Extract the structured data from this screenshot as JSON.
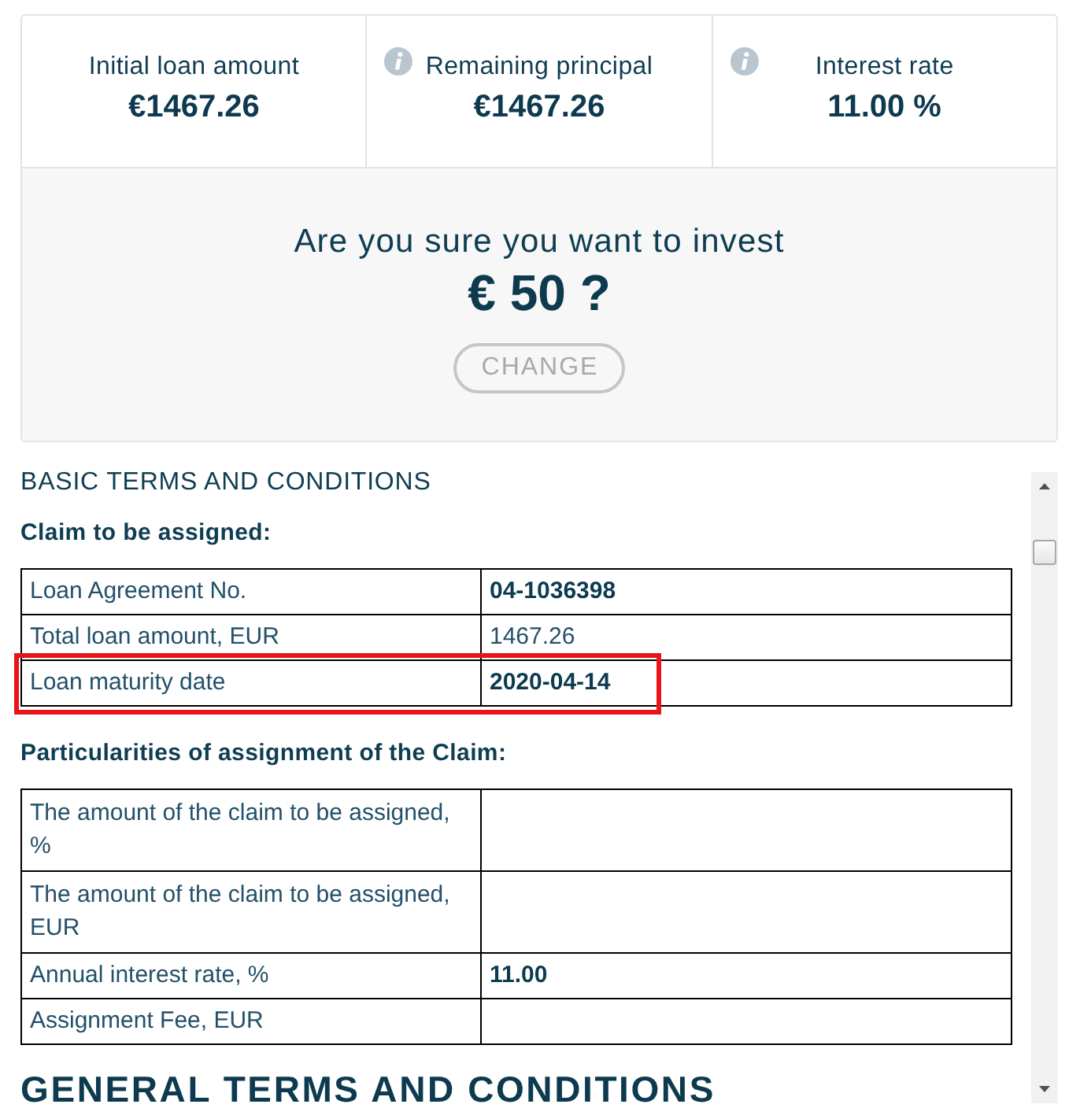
{
  "summary": {
    "stats": [
      {
        "label": "Initial loan amount",
        "value": "€1467.26",
        "info": false
      },
      {
        "label": "Remaining principal",
        "value": "€1467.26",
        "info": true
      },
      {
        "label": "Interest rate",
        "value": "11.00 %",
        "info": true
      }
    ]
  },
  "confirm": {
    "question": "Are you sure you want to invest",
    "amount": "€ 50 ?",
    "button": "CHANGE"
  },
  "terms": {
    "heading": "BASIC TERMS AND CONDITIONS",
    "sections": [
      {
        "title": "Claim to be assigned:",
        "rows": [
          {
            "label": "Loan Agreement No.",
            "value": "04-1036398",
            "emphasis": true,
            "highlighted": false
          },
          {
            "label": "Total loan amount, EUR",
            "value": "1467.26",
            "emphasis": false,
            "highlighted": false
          },
          {
            "label": "Loan maturity date",
            "value": "2020-04-14",
            "emphasis": true,
            "highlighted": true
          }
        ]
      },
      {
        "title": "Particularities of assignment of the Claim:",
        "rows": [
          {
            "label": "The amount of the claim to be assigned, %",
            "highlighted": false
          },
          {
            "label": "The amount of the claim to be assigned, EUR",
            "highlighted": false
          },
          {
            "label": "Annual interest rate, %",
            "value": "11.00",
            "emphasis": true,
            "highlighted": false
          },
          {
            "label": "Assignment Fee, EUR",
            "highlighted": false
          }
        ]
      }
    ],
    "next_heading": "GENERAL TERMS AND CONDITIONS"
  }
}
